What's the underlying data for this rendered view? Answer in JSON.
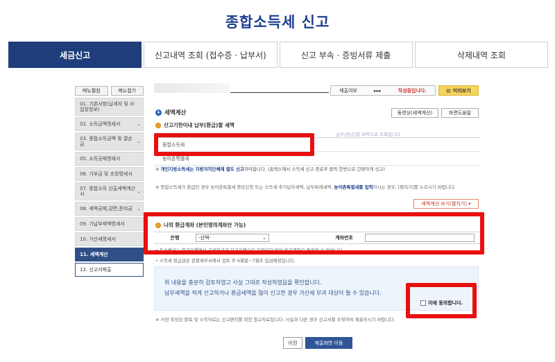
{
  "page_title": "종합소득세 신고",
  "top_tabs": [
    {
      "label": "세금신고",
      "active": true
    },
    {
      "label": "신고내역 조회 (접수증 · 납부서)",
      "active": false
    },
    {
      "label": "신고 부속 · 증빙서류 제출",
      "active": false
    },
    {
      "label": "삭제내역 조회",
      "active": false
    }
  ],
  "sidebar": {
    "expand_all": "메뉴펼침",
    "collapse_all": "메뉴접기",
    "items": [
      {
        "label": "01. 기본사항(납세자 및 사업장정보)"
      },
      {
        "label": "02. 소득금액명세서"
      },
      {
        "label": "03. 종합소득금액 및 결손금"
      },
      {
        "label": "05. 소득공제명세서"
      },
      {
        "label": "06. 기부금 및 조정명세서"
      },
      {
        "label": "07. 종합소득 산출세액계산서"
      },
      {
        "label": "08. 세액공제,감면,준비금"
      },
      {
        "label": "09. 기납부세액명세서"
      },
      {
        "label": "10. 가산세명세서"
      },
      {
        "label": "11. 세액계산"
      },
      {
        "label": "12. 신고서제출"
      }
    ]
  },
  "status": {
    "label": "제출여부",
    "arrows": "▸▸▸",
    "value": "작성중입니다.",
    "preview_label": "미리보기"
  },
  "section": {
    "title": "세액계산",
    "video_button": "동영상(세액계산)",
    "help_button": "화면도움말",
    "subtitle": "신고기한이내 납부(환급)할 세액",
    "faded_note": "납부(환급)할 세액으로 조회합니다.",
    "rows": [
      "종합소득세",
      "농어촌특별세"
    ],
    "note1_bold": "개인지방소득세는 지방자치단체에 별도 신고",
    "note1_rest": "하여합니다. (홈택스에서 소득세 신고 종료후 클릭 한번으로 간편하게 신고)",
    "note2_a": "종합소득세가 환급인 경우 농어촌특별세 중당신청 또는 소득세 추가납부세액, 납부특례세액, ",
    "note2_blue": "농어촌특별세를 입력",
    "note2_b": "하시는 경우, [펼치기]를 누르시기 바랍니다.",
    "calc_button": "세액계산 보기(펼치기) ▾"
  },
  "refund": {
    "title": "나의 환급계좌 (본인명의계좌만 가능)",
    "bank_label": "은행",
    "bank_value": "-선택-",
    "account_label": "계좌번호",
    "account_value": "",
    "note1": "토스뱅크는 한국은행에서 국세환급금 지급은행으로 지정되지 않아 환급계좌로 등록할 수 없습니다.",
    "note2": "소득세 환급금은 관할세무서에서 검토 후 6월말~7월초 입금예정입니다."
  },
  "confirm": {
    "line1": "위 내용을 충분히 검토하였고 사실 그대로 작성하였음을 확인합니다.",
    "line2": "납부세액을 적게 신고하거나 환급세액을 많이 신고한 경우 가산세 부과 대상이 될 수 있습니다.",
    "agree": "이에 동의합니다."
  },
  "footer_note": "사전 작성된 항목 및 소득자료는 신고편의를 위한 참고자료입니다. 사실과 다른 경우 신고서를 수정하여 제출하시기 바랍니다.",
  "buttons": {
    "prev": "이전",
    "submit": "제출화면 이동"
  }
}
